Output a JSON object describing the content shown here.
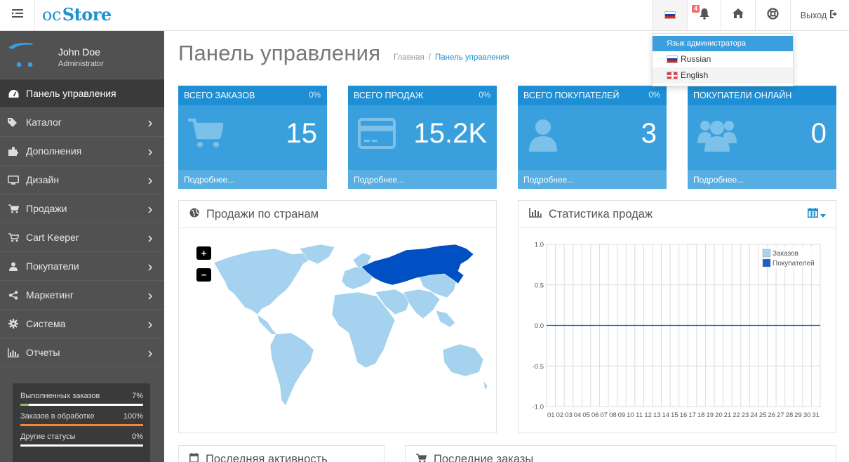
{
  "header": {
    "logo_oc": "oc",
    "logo_store": "Store",
    "notification_count": "4",
    "logout_label": "Выход"
  },
  "language_menu": {
    "header": "Язык администратора",
    "items": [
      {
        "label": "Russian",
        "flag": "ru"
      },
      {
        "label": "English",
        "flag": "gb"
      }
    ]
  },
  "profile": {
    "name": "John Doe",
    "role": "Administrator"
  },
  "sidebar": {
    "items": [
      {
        "label": "Панель управления",
        "icon": "dashboard-icon",
        "active": true
      },
      {
        "label": "Каталог",
        "icon": "tags-icon"
      },
      {
        "label": "Дополнения",
        "icon": "puzzle-icon"
      },
      {
        "label": "Дизайн",
        "icon": "monitor-icon"
      },
      {
        "label": "Продажи",
        "icon": "cart-icon"
      },
      {
        "label": "Cart Keeper",
        "icon": "cart-arrow-icon"
      },
      {
        "label": "Покупатели",
        "icon": "user-icon"
      },
      {
        "label": "Маркетинг",
        "icon": "share-icon"
      },
      {
        "label": "Система",
        "icon": "cog-icon"
      },
      {
        "label": "Отчеты",
        "icon": "bar-chart-icon"
      }
    ]
  },
  "order_stats": [
    {
      "label": "Выполненных заказов",
      "value": "7%",
      "fraction": 0.07,
      "color": "#8fbb6c"
    },
    {
      "label": "Заказов в обработке",
      "value": "100%",
      "fraction": 1.0,
      "color": "#f38733"
    },
    {
      "label": "Другие статусы",
      "value": "0%",
      "fraction": 0.0,
      "color": "#3aa0dd"
    }
  ],
  "page": {
    "title": "Панель управления",
    "breadcrumb_home": "Главная",
    "breadcrumb_separator": "/",
    "breadcrumb_current": "Панель управления"
  },
  "tiles": [
    {
      "title": "ВСЕГО ЗАКАЗОВ",
      "percent": "0%",
      "value": "15",
      "more": "Подробнее...",
      "icon": "shopping-cart-icon"
    },
    {
      "title": "ВСЕГО ПРОДАЖ",
      "percent": "0%",
      "value": "15.2K",
      "more": "Подробнее...",
      "icon": "credit-card-icon"
    },
    {
      "title": "ВСЕГО ПОКУПАТЕЛЕЙ",
      "percent": "0%",
      "value": "3",
      "more": "Подробнее...",
      "icon": "user-icon"
    },
    {
      "title": "ПОКУПАТЕЛИ ОНЛАЙН",
      "percent": "",
      "value": "0",
      "more": "Подробнее...",
      "icon": "users-icon"
    }
  ],
  "map_panel": {
    "title": "Продажи по странам",
    "zoom_in": "+",
    "zoom_out": "−",
    "land_color": "#a5d2ef",
    "highlight_color": "#0050c4"
  },
  "stats_panel": {
    "title": "Статистика продаж"
  },
  "chart_data": {
    "type": "line",
    "x": [
      "01",
      "02",
      "03",
      "04",
      "05",
      "06",
      "07",
      "08",
      "09",
      "10",
      "11",
      "12",
      "13",
      "14",
      "15",
      "16",
      "17",
      "18",
      "19",
      "20",
      "21",
      "22",
      "23",
      "24",
      "25",
      "26",
      "27",
      "28",
      "29",
      "30",
      "31"
    ],
    "series": [
      {
        "name": "Заказов",
        "color": "#a9d2f0",
        "values": [
          0,
          0,
          0,
          0,
          0,
          0,
          0,
          0,
          0,
          0,
          0,
          0,
          0,
          0,
          0,
          0,
          0,
          0,
          0,
          0,
          0,
          0,
          0,
          0,
          0,
          0,
          0,
          0,
          0,
          0,
          0
        ]
      },
      {
        "name": "Покупателей",
        "color": "#1e5fc7",
        "values": [
          0,
          0,
          0,
          0,
          0,
          0,
          0,
          0,
          0,
          0,
          0,
          0,
          0,
          0,
          0,
          0,
          0,
          0,
          0,
          0,
          0,
          0,
          0,
          0,
          0,
          0,
          0,
          0,
          0,
          0,
          0
        ]
      }
    ],
    "yticks": [
      "1.0",
      "0.5",
      "0.0",
      "-0.5",
      "-1.0"
    ],
    "ylim": [
      -1,
      1
    ],
    "grid": true,
    "legend_position": "top-right"
  },
  "activity_panel": {
    "title": "Последняя активность"
  },
  "orders_panel": {
    "title": "Последние заказы"
  }
}
